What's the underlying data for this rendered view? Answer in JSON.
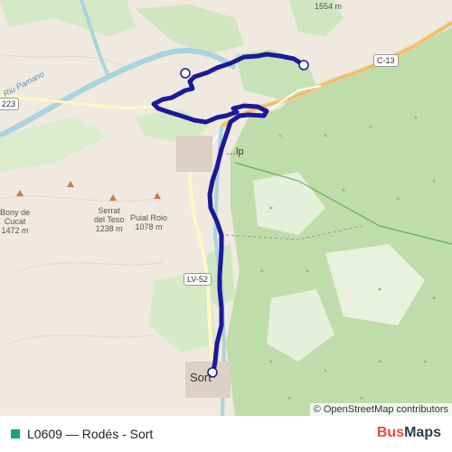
{
  "map": {
    "labels": {
      "peak_top": "1554 m",
      "bony": "Bony de\nCucat\n1472 m",
      "serrat": "Serrat\ndel Teso\n1238 m",
      "puial": "Puial Roio\n1078 m",
      "river": "Riu Pamano",
      "place_mid": "…lp",
      "town": "Sort"
    },
    "road_shields": {
      "c13": "C-13",
      "lv52": "LV-52",
      "r223": "223"
    },
    "attribution": "© OpenStreetMap contributors"
  },
  "route": {
    "code": "L0609",
    "separator": " — ",
    "name": "Rodés - Sort",
    "color": "#1a1a99",
    "swatch_color": "#16a085"
  },
  "brand": {
    "part1": "Bus",
    "part2": "Maps"
  }
}
